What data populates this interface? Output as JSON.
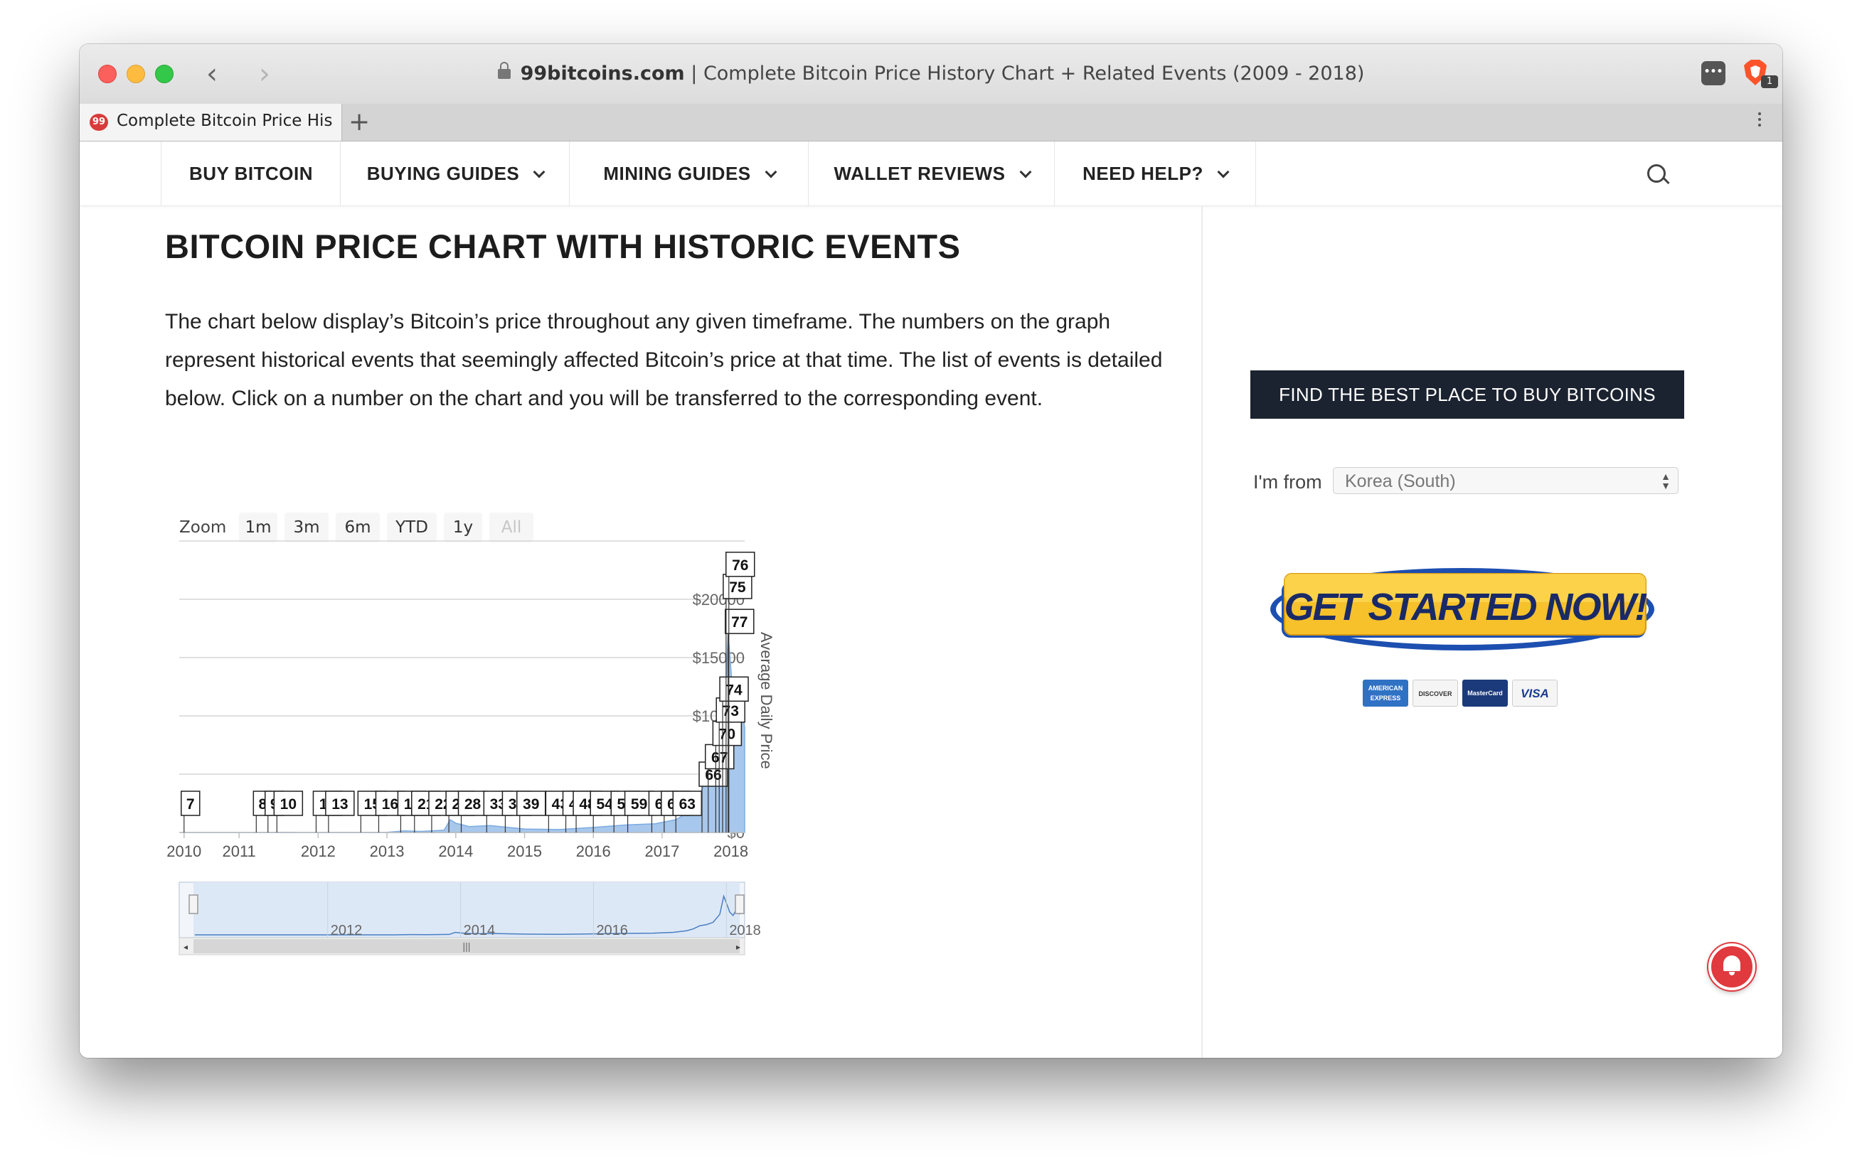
{
  "browser": {
    "url_domain": "99bitcoins.com",
    "url_separator": " | ",
    "page_title": "Complete Bitcoin Price History Chart + Related Events (2009 - 2018)",
    "tab_title": "Complete Bitcoin Price His",
    "favicon_text": "99",
    "new_tab": "+",
    "back": "‹",
    "forward": "›",
    "ext_label": "•••",
    "brave_badge": "1"
  },
  "nav": {
    "items": [
      {
        "label": "BUY BITCOIN",
        "dropdown": false
      },
      {
        "label": "BUYING GUIDES",
        "dropdown": true
      },
      {
        "label": "MINING GUIDES",
        "dropdown": true
      },
      {
        "label": "WALLET REVIEWS",
        "dropdown": true
      },
      {
        "label": "NEED HELP?",
        "dropdown": true
      }
    ]
  },
  "main": {
    "heading": "BITCOIN PRICE CHART WITH HISTORIC EVENTS",
    "intro": "The chart below display’s Bitcoin’s price throughout any given timeframe. The numbers on the graph represent historical events that seemingly affected Bitcoin’s price at that time. The list of events is detailed below. Click on a number on the chart and you will be transferred to the corresponding event."
  },
  "chart": {
    "zoom_label": "Zoom",
    "zoom_buttons": [
      "1m",
      "3m",
      "6m",
      "YTD",
      "1y",
      "All"
    ],
    "zoom_disabled": "All"
  },
  "chart_data": {
    "type": "area",
    "ylabel": "Average Daily Price",
    "y_ticks": [
      "$0",
      "$5000",
      "$10000",
      "$15000",
      "$20000"
    ],
    "ylim": [
      0,
      25000
    ],
    "x_ticks": [
      "2010",
      "2011",
      "2012",
      "2013",
      "2014",
      "2015",
      "2016",
      "2017",
      "2018"
    ],
    "navigator_ticks": [
      "2012",
      "2014",
      "2016",
      "2018"
    ],
    "series": [
      {
        "x": [
          2010.0,
          2010.5,
          2011.0,
          2011.4,
          2011.5,
          2011.8,
          2012.0,
          2012.5,
          2013.0,
          2013.25,
          2013.5,
          2013.83,
          2013.92,
          2014.0,
          2014.2,
          2014.5,
          2015.0,
          2015.5,
          2016.0,
          2016.5,
          2016.9,
          2017.2,
          2017.4,
          2017.5,
          2017.6,
          2017.7,
          2017.8,
          2017.9,
          2017.96,
          2018.0,
          2018.05,
          2018.1,
          2018.15,
          2018.2
        ],
        "values": [
          0,
          0.1,
          0.3,
          15,
          10,
          3,
          5,
          7,
          13,
          140,
          90,
          200,
          1100,
          800,
          500,
          600,
          300,
          250,
          430,
          650,
          750,
          1100,
          1800,
          2600,
          4000,
          4500,
          5500,
          9000,
          17000,
          14000,
          10000,
          8500,
          11000,
          9000
        ]
      }
    ],
    "event_flags": [
      {
        "label": "7",
        "x": 2010.05,
        "y": 0
      },
      {
        "label": "8",
        "x": 2011.1,
        "y": 0
      },
      {
        "label": "9",
        "x": 2011.27,
        "y": 0
      },
      {
        "label": "10",
        "x": 2011.4,
        "y": 0
      },
      {
        "label": "12",
        "x": 2011.97,
        "y": 0
      },
      {
        "label": "13",
        "x": 2012.15,
        "y": 0
      },
      {
        "label": "15",
        "x": 2012.62,
        "y": 0
      },
      {
        "label": "16",
        "x": 2012.88,
        "y": 0
      },
      {
        "label": "18",
        "x": 2013.2,
        "y": 0
      },
      {
        "label": "21",
        "x": 2013.4,
        "y": 0
      },
      {
        "label": "22",
        "x": 2013.65,
        "y": 0
      },
      {
        "label": "24",
        "x": 2013.9,
        "y": 0
      },
      {
        "label": "28",
        "x": 2014.08,
        "y": 0
      },
      {
        "label": "33",
        "x": 2014.45,
        "y": 0
      },
      {
        "label": "37",
        "x": 2014.72,
        "y": 0
      },
      {
        "label": "39",
        "x": 2014.93,
        "y": 0
      },
      {
        "label": "43",
        "x": 2015.35,
        "y": 0
      },
      {
        "label": "45",
        "x": 2015.6,
        "y": 0
      },
      {
        "label": "48",
        "x": 2015.75,
        "y": 0
      },
      {
        "label": "54",
        "x": 2016.0,
        "y": 0
      },
      {
        "label": "56",
        "x": 2016.3,
        "y": 0
      },
      {
        "label": "59",
        "x": 2016.5,
        "y": 0
      },
      {
        "label": "61",
        "x": 2016.85,
        "y": 0
      },
      {
        "label": "62",
        "x": 2017.03,
        "y": 0
      },
      {
        "label": "63",
        "x": 2017.2,
        "y": 0
      },
      {
        "label": "66",
        "x": 2017.58,
        "y": 2500
      },
      {
        "label": "67",
        "x": 2017.67,
        "y": 4000
      },
      {
        "label": "70",
        "x": 2017.78,
        "y": 6000
      },
      {
        "label": "73",
        "x": 2017.83,
        "y": 8000
      },
      {
        "label": "74",
        "x": 2017.88,
        "y": 9800
      },
      {
        "label": "77",
        "x": 2017.96,
        "y": 15600
      },
      {
        "label": "75",
        "x": 2017.93,
        "y": 18600
      },
      {
        "label": "76",
        "x": 2017.97,
        "y": 20500
      }
    ]
  },
  "sidebar": {
    "find_button": "FIND THE BEST PLACE TO BUY BITCOINS",
    "from_label": "I'm from",
    "country": "Korea (South)",
    "cta_text": "GET STARTED NOW!",
    "cards": [
      "AMERICAN EXPRESS",
      "DISCOVER",
      "MasterCard",
      "VISA"
    ]
  }
}
